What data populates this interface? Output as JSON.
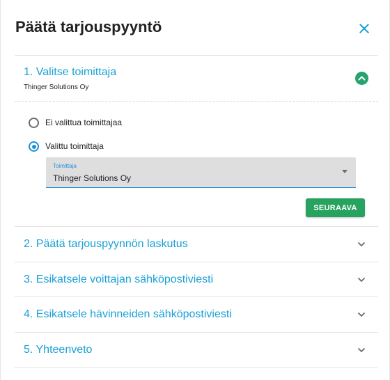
{
  "dialog": {
    "title": "Päätä tarjouspyyntö",
    "close_icon": "close-icon"
  },
  "steps": [
    {
      "label": "1. Valitse toimittaja",
      "subtitle": "Thinger Solutions Oy",
      "expanded": true,
      "icon": "chevron-up-circle-icon"
    },
    {
      "label": "2. Päätä tarjouspyynnön laskutus",
      "expanded": false,
      "icon": "chevron-down-icon"
    },
    {
      "label": "3. Esikatsele voittajan sähköpostiviesti",
      "expanded": false,
      "icon": "chevron-down-icon"
    },
    {
      "label": "4. Esikatsele hävinneiden sähköpostiviesti",
      "expanded": false,
      "icon": "chevron-down-icon"
    },
    {
      "label": "5. Yhteenveto",
      "expanded": false,
      "icon": "chevron-down-icon"
    }
  ],
  "step1": {
    "options": [
      {
        "label": "Ei valittua toimittajaa",
        "selected": false
      },
      {
        "label": "Valittu toimittaja",
        "selected": true
      }
    ],
    "supplier_select": {
      "label": "Toimittaja",
      "value": "Thinger Solutions Oy"
    },
    "next_label": "SEURAAVA"
  },
  "colors": {
    "accent": "#1aa1d6",
    "primary_button": "#27a35f",
    "radio_checked": "#1e90d8"
  }
}
